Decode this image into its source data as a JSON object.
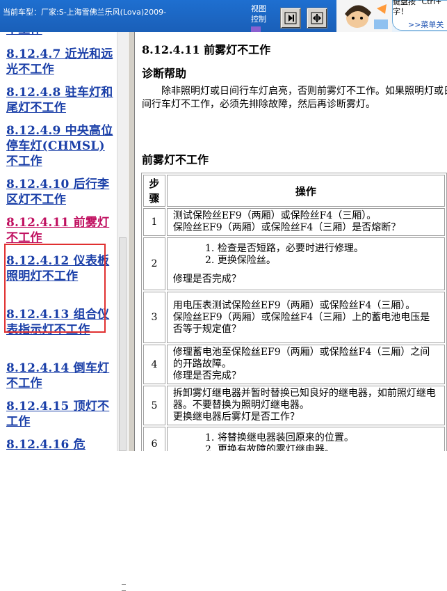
{
  "header": {
    "car_model": "当前车型：厂家:S-上海雪佛兰乐风(Lova)2009-",
    "view_control_line1": "视图",
    "view_control_line2": "控制",
    "hint_line1": "键盘按 \"Ctrl+",
    "hint_line2": "字！",
    "hint_link": ">>菜单关"
  },
  "nav": {
    "top_partial": "不工作",
    "items": [
      {
        "label": "8.12.4.7  近光和远光不工作"
      },
      {
        "label": "8.12.4.8  驻车灯和尾灯不工作"
      },
      {
        "label": "8.12.4.9  中央高位停车灯(CHMSL)不工作"
      },
      {
        "label": "8.12.4.10  后行李区灯不工作"
      },
      {
        "label": "8.12.4.11  前雾灯不工作"
      },
      {
        "label": "8.12.4.12  仪表板照明灯不工作"
      },
      {
        "label": "8.12.4.13  组合仪表指示灯不工作"
      },
      {
        "label": "8.12.4.14  倒车灯不工作"
      },
      {
        "label": "8.12.4.15  顶灯不工作"
      },
      {
        "label": "8.12.4.16  危"
      }
    ]
  },
  "content": {
    "title": "8.12.4.11  前雾灯不工作",
    "help_heading": "诊断帮助",
    "help_text": "除非照明灯或日间行车灯启亮，否则前雾灯不工作。如果照明灯或日间行车灯不工作，必须先排除故障，然后再诊断雾灯。",
    "section_title": "前雾灯不工作",
    "table": {
      "header_step": "步骤",
      "header_op": "操作",
      "rows": [
        {
          "step": "1",
          "lines": [
            "测试保险丝EF9（两厢）或保险丝F4（三厢）。",
            "保险丝EF9（两厢）或保险丝F4（三厢）是否熔断？"
          ],
          "list": [],
          "question": ""
        },
        {
          "step": "2",
          "lines": [],
          "list": [
            "检查是否短路，必要时进行修理。",
            "更换保险丝。"
          ],
          "question": "修理是否完成？"
        },
        {
          "step": "3",
          "lines": [
            "用电压表测试保险丝EF9（两厢）或保险丝F4（三厢）。",
            "保险丝EF9（两厢）或保险丝F4（三厢）上的蓄电池电压是否等于规定值？"
          ],
          "list": [],
          "question": ""
        },
        {
          "step": "4",
          "lines": [
            "修理蓄电池至保险丝EF9（两厢）或保险丝F4（三厢）之间的开路故障。",
            "修理是否完成？"
          ],
          "list": [],
          "question": ""
        },
        {
          "step": "5",
          "lines": [
            "拆卸雾灯继电器并暂时替换已知良好的继电器，如前照灯继电器。不要替换为照明灯继电器。",
            "更换继电器后雾灯是否工作？"
          ],
          "list": [],
          "question": ""
        },
        {
          "step": "6",
          "lines": [],
          "list": [
            "将替换继电器装回原来的位置。",
            "更换有故障的雾灯继电器。"
          ],
          "question": ""
        }
      ]
    }
  },
  "colors": {
    "header_bg": "#1e6fd0",
    "link": "#1a3fa8",
    "active_link": "#c01060",
    "highlight": "#e03030"
  }
}
